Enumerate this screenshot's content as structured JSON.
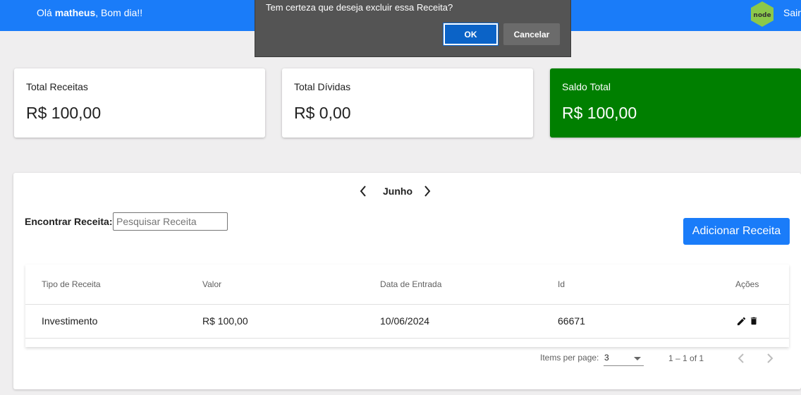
{
  "header": {
    "greeting_prefix": "Olá ",
    "user_name": "matheus",
    "greeting_suffix": ", Bom dia!!",
    "logo_icon": "nodejs-logo-icon",
    "logout_label": "Sair",
    "background_color": "#1a7cf9"
  },
  "confirm_dialog": {
    "message": "Tem certeza que deseja excluir essa Receita?",
    "ok_label": "OK",
    "cancel_label": "Cancelar"
  },
  "summary_cards": [
    {
      "label": "Total Receitas",
      "amount": "R$ 100,00"
    },
    {
      "label": "Total Dívidas",
      "amount": "R$ 0,00"
    },
    {
      "label": "Saldo Total",
      "amount": "R$ 100,00",
      "color": "#007f00"
    }
  ],
  "month_nav": {
    "month": "Junho",
    "prev_icon": "chevron-left-icon",
    "next_icon": "chevron-right-icon"
  },
  "search": {
    "label": "Encontrar Receita:",
    "placeholder": "Pesquisar Receita",
    "value": ""
  },
  "add_button_label": "Adicionar Receita",
  "table": {
    "columns": [
      "Tipo de Receita",
      "Valor",
      "Data de Entrada",
      "Id",
      "Ações"
    ],
    "rows": [
      {
        "tipo": "Investimento",
        "valor": "R$ 100,00",
        "data": "10/06/2024",
        "id": "66671",
        "actions": [
          "edit-icon",
          "delete-icon"
        ]
      }
    ]
  },
  "paginator": {
    "items_per_page_label": "Items per page:",
    "items_per_page_value": "3",
    "range_label": "1 – 1 of 1",
    "prev_icon": "chevron-left-icon",
    "next_icon": "chevron-right-icon"
  }
}
